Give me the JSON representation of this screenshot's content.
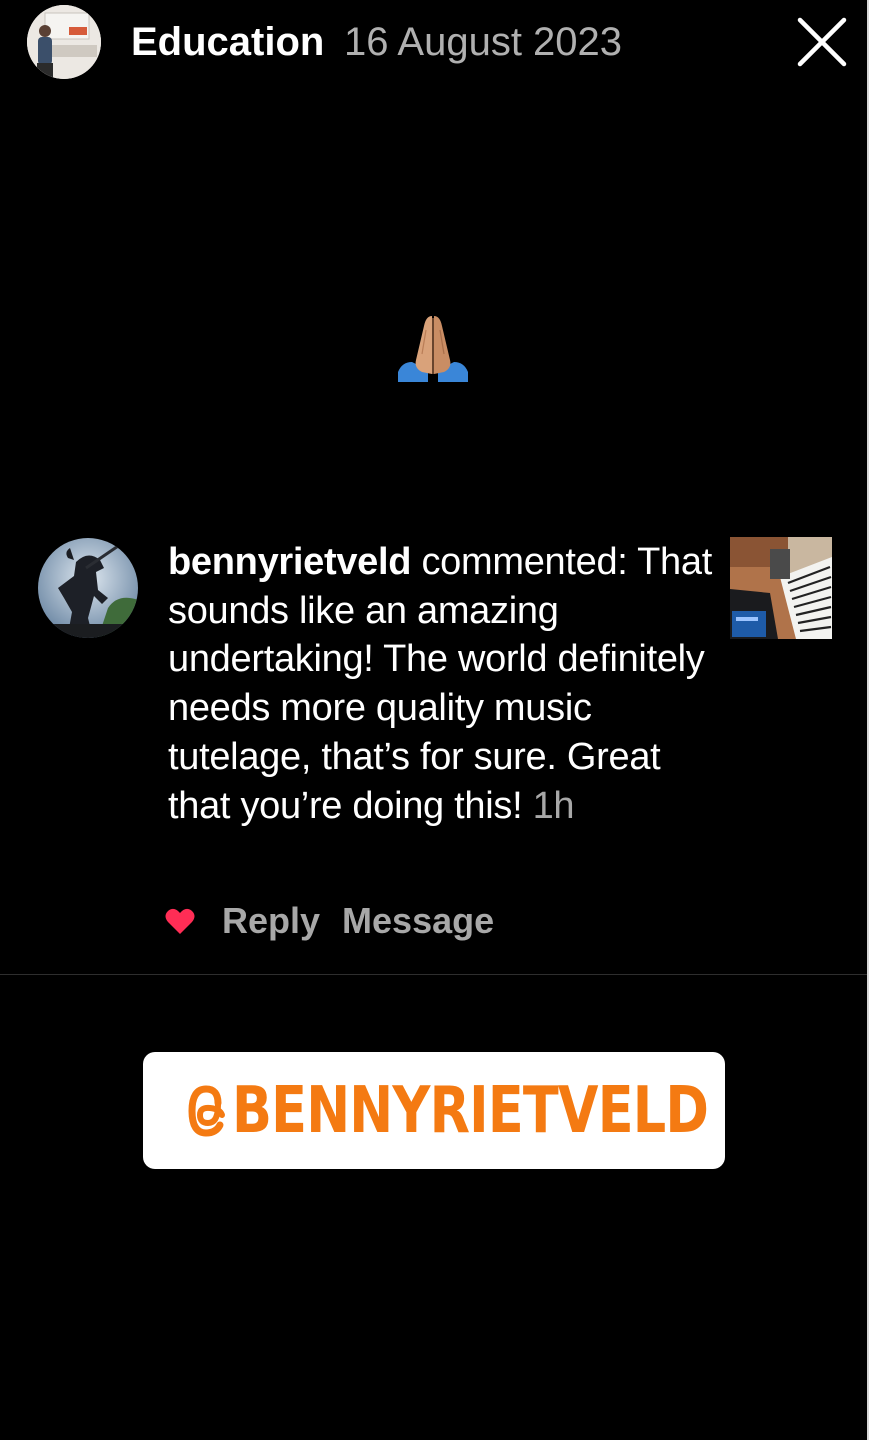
{
  "header": {
    "title": "Education",
    "date": "16 August 2023",
    "close_icon": "close-icon"
  },
  "story_content": {
    "emoji": "folded-hands-emoji"
  },
  "comment": {
    "username": "bennyrietveld",
    "action": " commented:",
    "text": "That sounds like an amazing undertaking!  The world definitely needs more quality music tutelage, that’s for sure.  Great that you’re doing this!",
    "time": "1h",
    "actions": {
      "like_icon": "heart-icon",
      "reply": "Reply",
      "message": "Message"
    },
    "colors": {
      "heart": "#ff2d55",
      "muted": "#a8a8a8"
    }
  },
  "mention_sticker": {
    "label": "BENNYRIETVELD",
    "icon": "threads-icon",
    "color": "#f47a12",
    "background": "#ffffff"
  }
}
